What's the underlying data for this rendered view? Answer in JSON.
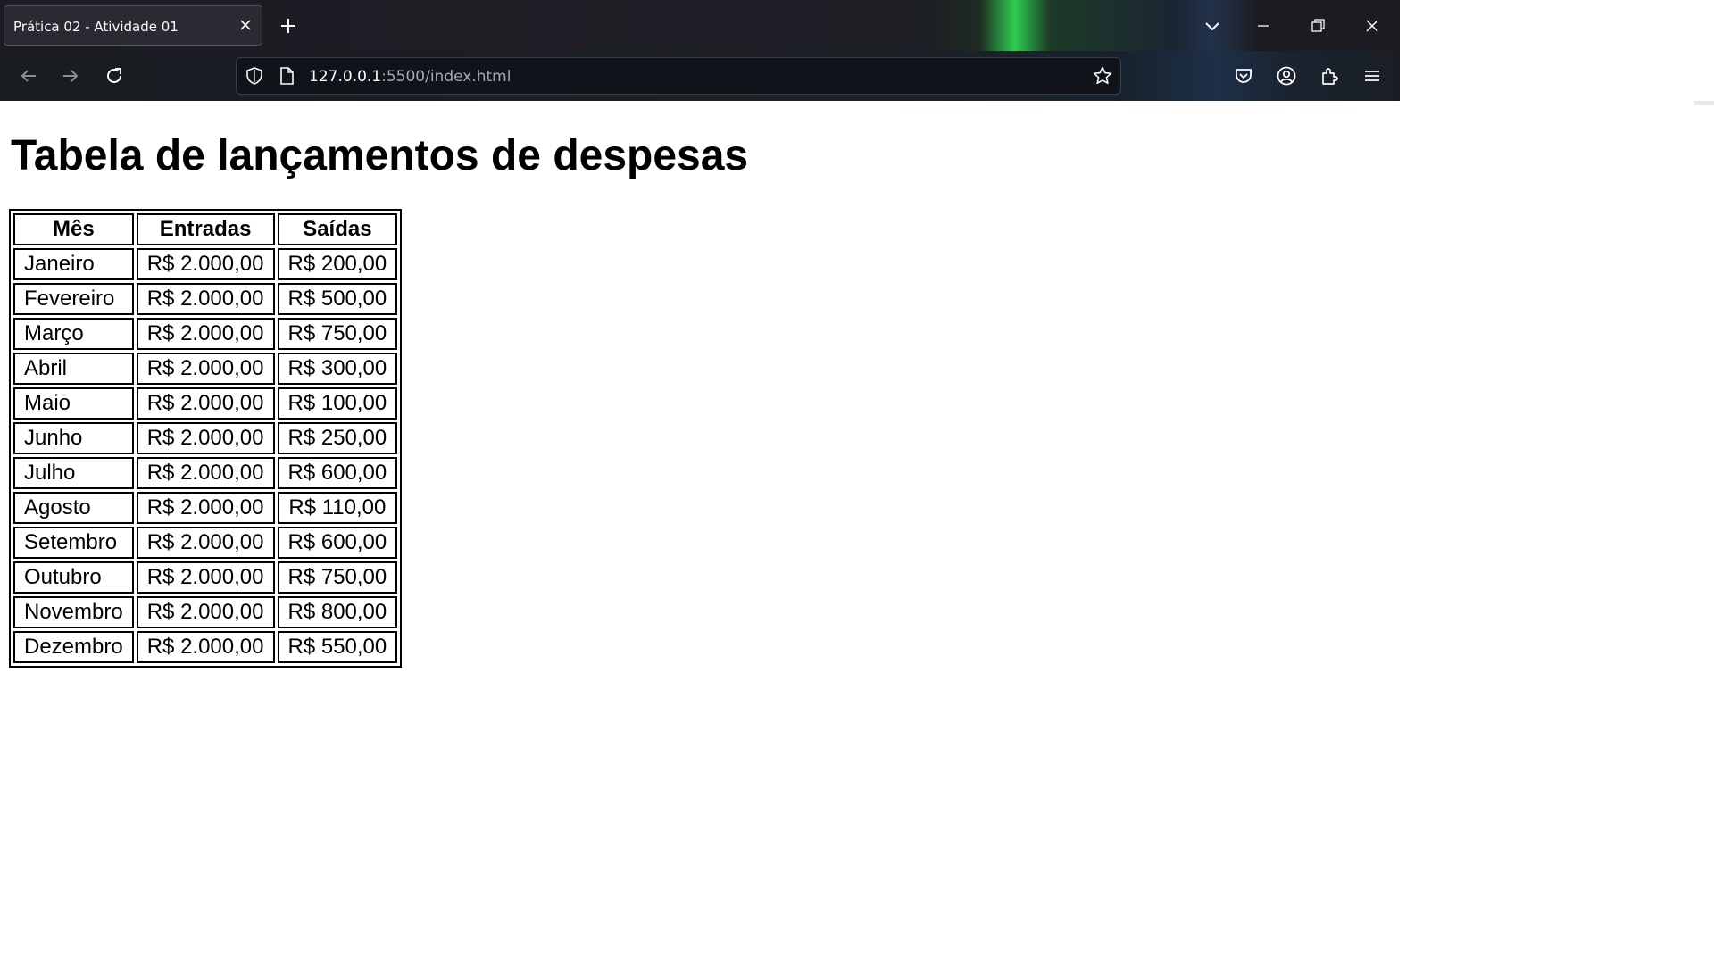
{
  "browser": {
    "tab_title": "Prática 02 - Atividade 01",
    "url_host": "127.0.0.1",
    "url_rest": ":5500/index.html"
  },
  "page": {
    "heading": "Tabela de lançamentos de despesas",
    "table": {
      "headers": [
        "Mês",
        "Entradas",
        "Saídas"
      ],
      "rows": [
        [
          "Janeiro",
          "R$ 2.000,00",
          "R$ 200,00"
        ],
        [
          "Fevereiro",
          "R$ 2.000,00",
          "R$ 500,00"
        ],
        [
          "Março",
          "R$ 2.000,00",
          "R$ 750,00"
        ],
        [
          "Abril",
          "R$ 2.000,00",
          "R$ 300,00"
        ],
        [
          "Maio",
          "R$ 2.000,00",
          "R$ 100,00"
        ],
        [
          "Junho",
          "R$ 2.000,00",
          "R$ 250,00"
        ],
        [
          "Julho",
          "R$ 2.000,00",
          "R$ 600,00"
        ],
        [
          "Agosto",
          "R$ 2.000,00",
          "R$ 110,00"
        ],
        [
          "Setembro",
          "R$ 2.000,00",
          "R$ 600,00"
        ],
        [
          "Outubro",
          "R$ 2.000,00",
          "R$ 750,00"
        ],
        [
          "Novembro",
          "R$ 2.000,00",
          "R$ 800,00"
        ],
        [
          "Dezembro",
          "R$ 2.000,00",
          "R$ 550,00"
        ]
      ]
    }
  }
}
